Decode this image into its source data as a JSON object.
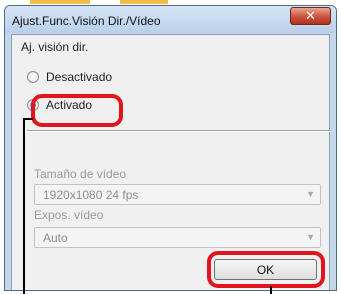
{
  "window": {
    "title": "Ajust.Func.Visión Dir./Vídeo",
    "close_glyph": "✕"
  },
  "live_view": {
    "section_label": "Aj. visión dir.",
    "options": [
      {
        "label": "Desactivado",
        "selected": false
      },
      {
        "label": "Activado",
        "selected": true
      }
    ]
  },
  "movie": {
    "size_label": "Tamaño de vídeo",
    "size_value": "1920x1080  24 fps",
    "exposure_label": "Expos. vídeo",
    "exposure_value": "Auto",
    "enabled": false
  },
  "buttons": {
    "ok_label": "OK"
  },
  "colors": {
    "highlight": "#e2141c",
    "tab_stub": "#f2c04a",
    "title_bar": "#c4d6ea"
  }
}
